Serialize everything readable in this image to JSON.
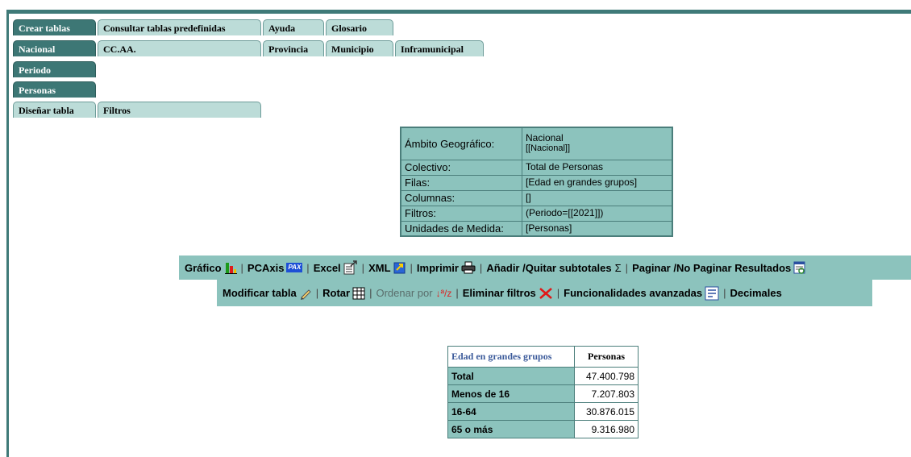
{
  "tabs": {
    "row1": [
      "Crear tablas",
      "Consultar tablas predefinidas",
      "Ayuda",
      "Glosario"
    ],
    "row2": [
      "Nacional",
      "CC.AA.",
      "Provincia",
      "Municipio",
      "Inframunicipal"
    ],
    "row3": [
      "Periodo"
    ],
    "row4": [
      "Personas"
    ],
    "row5": [
      "Diseñar tabla",
      "Filtros"
    ]
  },
  "info": {
    "ambito_label": "Ámbito Geográfico:",
    "ambito_value1": "Nacional",
    "ambito_value2": "[[Nacional]]",
    "colectivo_label": "Colectivo:",
    "colectivo_value": "Total de Personas",
    "filas_label": "Filas:",
    "filas_value": "[Edad en grandes grupos]",
    "columnas_label": "Columnas:",
    "columnas_value": "[]",
    "filtros_label": "Filtros:",
    "filtros_value": "(Periodo=[[2021]])",
    "unidades_label": "Unidades de Medida:",
    "unidades_value": "[Personas]"
  },
  "toolbar": {
    "separator": "|",
    "grafico": "Gráfico",
    "pcaxis": "PCAxis",
    "pcaxis_badge": "PAX",
    "excel": "Excel",
    "xml": "XML",
    "imprimir": "Imprimir",
    "subtotales": "Añadir /Quitar subtotales",
    "sigma": "Σ",
    "paginar": "Paginar /No Paginar Resultados",
    "modificar": "Modificar tabla",
    "rotar": "Rotar",
    "ordenar": "Ordenar por",
    "sort_glyph": "↓ª/z",
    "eliminar": "Eliminar filtros",
    "funcionalidades": "Funcionalidades avanzadas",
    "decimales": "Decimales"
  },
  "icons": {
    "grafico": "bar-chart-icon",
    "pcaxis": "pax-icon",
    "excel": "excel-export-icon",
    "xml": "xml-export-icon",
    "imprimir": "printer-icon",
    "paginar": "paginate-icon",
    "modificar": "pencil-icon",
    "rotar": "rotate-grid-icon",
    "ordenar": "sort-icon",
    "eliminar": "red-x-icon",
    "funcionalidades": "advanced-list-icon"
  },
  "colors": {
    "dark_teal": "#3d7775",
    "light_teal": "#bcdcd8",
    "table_bg": "#8cc3bd",
    "border": "#4b7e7b",
    "header_link": "#3b5a9a"
  },
  "results": {
    "headers": [
      "Edad en grandes grupos",
      "Personas"
    ],
    "rows": [
      {
        "label": "Total",
        "value": "47.400.798"
      },
      {
        "label": "Menos de 16",
        "value": "7.207.803"
      },
      {
        "label": "16-64",
        "value": "30.876.015"
      },
      {
        "label": "65 o más",
        "value": "9.316.980"
      }
    ]
  }
}
